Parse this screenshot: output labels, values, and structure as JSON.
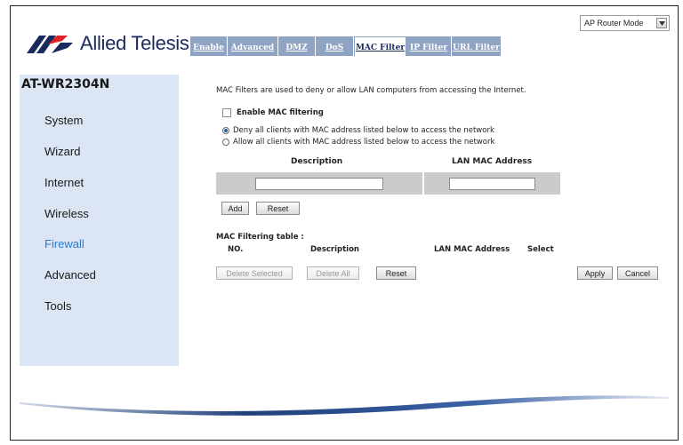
{
  "app": {
    "brand_name": "Allied Telesis",
    "model": "AT-WR2304N",
    "mode_select": {
      "value": "AP Router Mode"
    }
  },
  "tabs": [
    {
      "label": "Enable",
      "active": false
    },
    {
      "label": "Advanced",
      "active": false
    },
    {
      "label": "DMZ",
      "active": false
    },
    {
      "label": "DoS",
      "active": false
    },
    {
      "label": "MAC Filter",
      "active": true
    },
    {
      "label": "IP Filter",
      "active": false
    },
    {
      "label": "URL Filter",
      "active": false
    }
  ],
  "sidebar": {
    "items": [
      {
        "label": "System",
        "active": false
      },
      {
        "label": "Wizard",
        "active": false
      },
      {
        "label": "Internet",
        "active": false
      },
      {
        "label": "Wireless",
        "active": false
      },
      {
        "label": "Firewall",
        "active": true
      },
      {
        "label": "Advanced",
        "active": false
      },
      {
        "label": "Tools",
        "active": false
      }
    ]
  },
  "main": {
    "intro": "MAC Filters are used to deny or allow LAN computers from accessing the Internet.",
    "enable_label": "Enable MAC filtering",
    "enable_checked": false,
    "deny_label": "Deny all clients with MAC address listed below to access the network",
    "allow_label": "Allow all clients with MAC address listed below to access the network",
    "selected_policy": "deny",
    "form": {
      "description_header": "Description",
      "mac_header": "LAN MAC Address",
      "description_value": "",
      "mac_value": "",
      "add_label": "Add",
      "reset_label": "Reset"
    },
    "table": {
      "title": "MAC Filtering table :",
      "columns": [
        "NO.",
        "Description",
        "LAN MAC Address",
        "Select"
      ],
      "rows": [],
      "delete_selected_label": "Delete Selected",
      "delete_all_label": "Delete All",
      "reset_label": "Reset"
    },
    "apply_label": "Apply",
    "cancel_label": "Cancel"
  },
  "colors": {
    "tab_bg": "#8fa3c4",
    "sidebar_bg": "#dbe5f3",
    "active_nav": "#2b7bcf",
    "brand_navy": "#1b2a5c",
    "brand_red": "#e0222a"
  }
}
